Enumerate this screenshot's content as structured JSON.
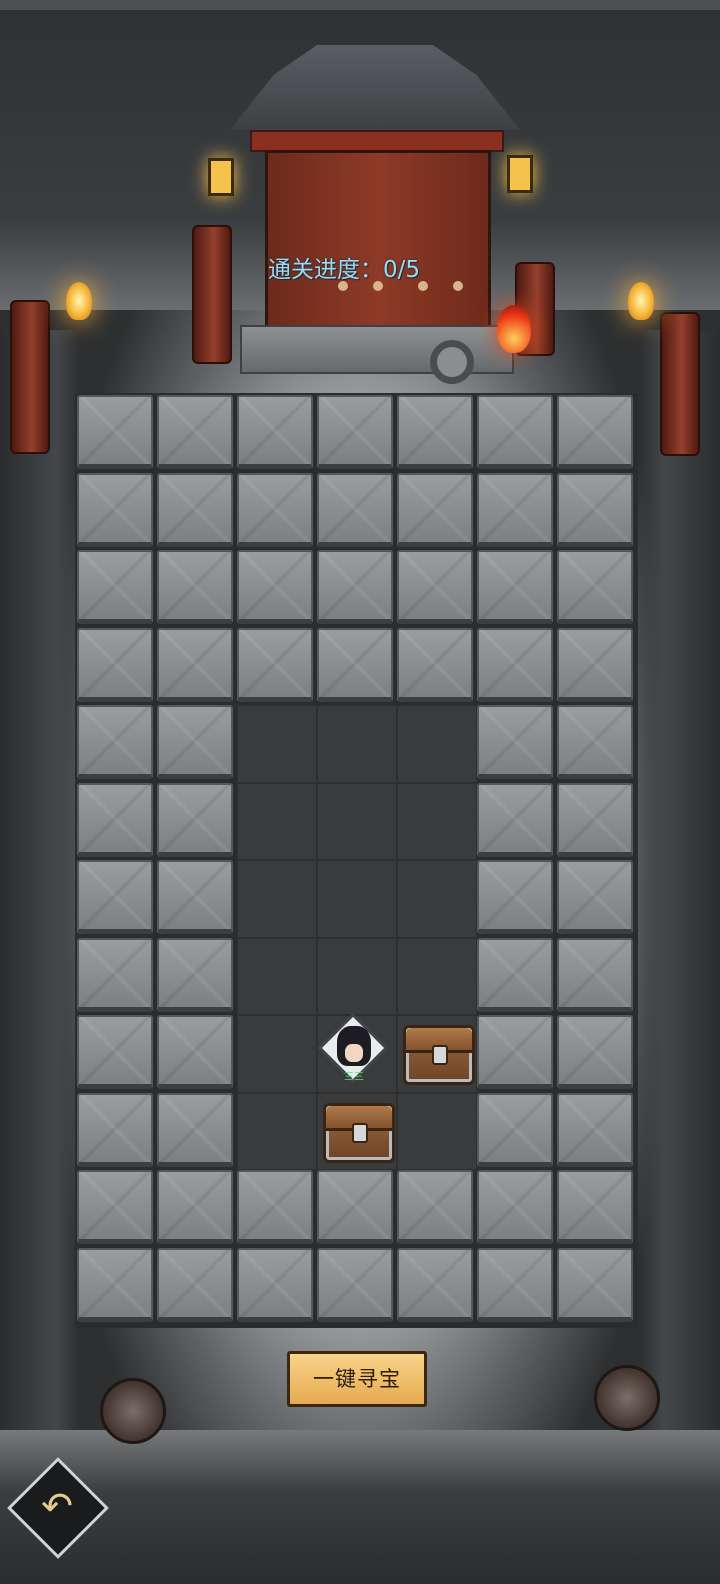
{
  "hud": {
    "progress_text": "通关进度：0/5"
  },
  "board": {
    "cols": 7,
    "rows": 12,
    "floor_cells": [
      [
        4,
        2
      ],
      [
        4,
        3
      ],
      [
        4,
        4
      ],
      [
        5,
        2
      ],
      [
        5,
        3
      ],
      [
        5,
        4
      ],
      [
        6,
        2
      ],
      [
        6,
        3
      ],
      [
        6,
        4
      ],
      [
        7,
        2
      ],
      [
        7,
        3
      ],
      [
        7,
        4
      ],
      [
        8,
        2
      ],
      [
        8,
        3
      ],
      [
        8,
        4
      ],
      [
        9,
        2
      ],
      [
        9,
        3
      ],
      [
        9,
        4
      ]
    ],
    "chests": [
      [
        8,
        4
      ],
      [
        9,
        3
      ]
    ],
    "hero": [
      8,
      3
    ]
  },
  "hero": {
    "tag": "三三"
  },
  "actions": {
    "treasure_button": "一键寻宝",
    "back_icon": "↶"
  },
  "colors": {
    "progress_text": "#9fd8ee",
    "button_bg": "#f2c46e"
  }
}
